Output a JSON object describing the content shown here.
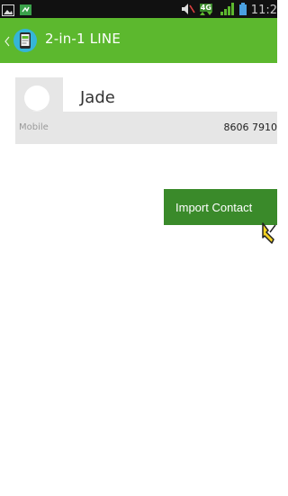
{
  "status_bar": {
    "time": "11:2",
    "network_badge": "4G",
    "icons": [
      "image-icon",
      "notification-icon",
      "mute-icon",
      "4g-icon",
      "signal-bars-icon",
      "battery-icon"
    ]
  },
  "action_bar": {
    "title": "2-in-1 LINE",
    "background_color": "#5cb82e",
    "icons": [
      "back-chevron-icon",
      "app-icon"
    ]
  },
  "contact": {
    "name": "Jade",
    "phone_label": "Mobile",
    "phone_number": "8606 7910"
  },
  "import_button": {
    "label": "Import Contact",
    "color": "#3a8a2a"
  },
  "cursor": {
    "icon": "pointer-hand-icon"
  }
}
